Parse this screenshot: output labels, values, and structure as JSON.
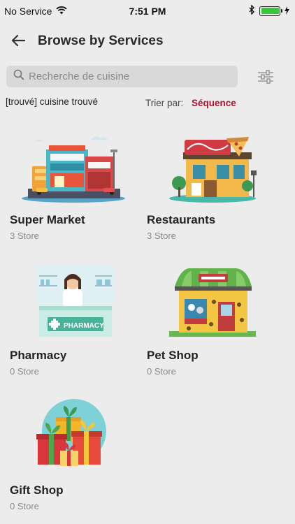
{
  "status_bar": {
    "carrier": "No Service",
    "time": "7:51 PM",
    "battery_level": 1.0,
    "battery_color": "#3bc63b"
  },
  "header": {
    "title": "Browse by Services",
    "back_icon": "arrow-left-icon"
  },
  "search": {
    "placeholder": "Recherche de cuisine",
    "value": "",
    "filter_icon": "sliders-icon"
  },
  "results_bar": {
    "found_text": "[trouvé] cuisine trouvé",
    "sort_label": "Trier par:",
    "sort_value": "Séquence",
    "sort_color": "#b0122e"
  },
  "services": [
    {
      "name": "Super Market",
      "count": "3 Store",
      "icon": "supermarket-illustration"
    },
    {
      "name": "Restaurants",
      "count": "3 Store",
      "icon": "restaurant-illustration"
    },
    {
      "name": "Pharmacy",
      "count": "0 Store",
      "icon": "pharmacy-illustration",
      "sign": "PHARMACY"
    },
    {
      "name": "Pet Shop",
      "count": "0 Store",
      "icon": "petshop-illustration"
    },
    {
      "name": "Gift Shop",
      "count": "0 Store",
      "icon": "giftshop-illustration"
    }
  ]
}
